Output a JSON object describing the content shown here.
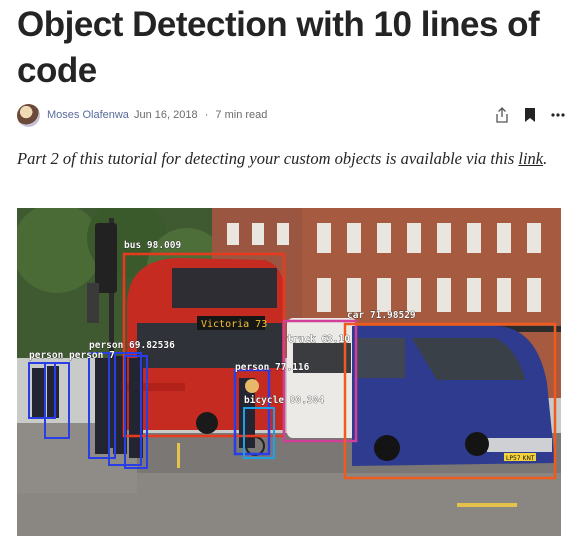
{
  "article": {
    "title": "Object Detection with 10 lines of code",
    "author": "Moses Olafenwa",
    "date": "Jun 16, 2018",
    "separator": "·",
    "read_time": "7 min read"
  },
  "toolbar": {
    "share_icon": "share-icon",
    "bookmark_icon": "bookmark-icon",
    "more_icon": "more-icon"
  },
  "intro": {
    "before": "Part 2 of this tutorial for detecting your custom objects is available via this ",
    "link": "link",
    "after": "."
  },
  "image": {
    "labels": {
      "bus": "bus 98.009",
      "car": "car 71.98529",
      "truck": "truck 63.10",
      "person_center": "person 77.116",
      "bicycle": "bicycle 80.304",
      "person_group": "person 69.82536",
      "person_left": "person person 7"
    },
    "bus_sign": "Victoria 73",
    "plate": "LP57 KNT"
  }
}
